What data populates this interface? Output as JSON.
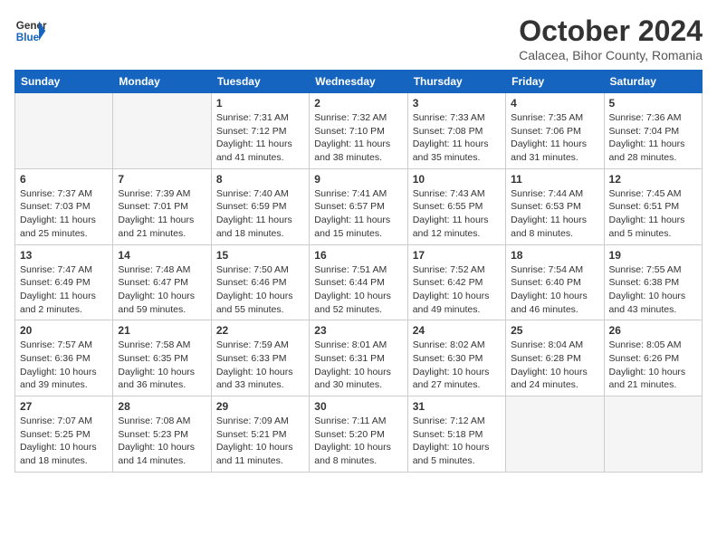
{
  "header": {
    "logo": {
      "line1": "General",
      "line2": "Blue"
    },
    "title": "October 2024",
    "subtitle": "Calacea, Bihor County, Romania"
  },
  "weekdays": [
    "Sunday",
    "Monday",
    "Tuesday",
    "Wednesday",
    "Thursday",
    "Friday",
    "Saturday"
  ],
  "weeks": [
    [
      {
        "day": "",
        "info": ""
      },
      {
        "day": "",
        "info": ""
      },
      {
        "day": "1",
        "info": "Sunrise: 7:31 AM\nSunset: 7:12 PM\nDaylight: 11 hours and 41 minutes."
      },
      {
        "day": "2",
        "info": "Sunrise: 7:32 AM\nSunset: 7:10 PM\nDaylight: 11 hours and 38 minutes."
      },
      {
        "day": "3",
        "info": "Sunrise: 7:33 AM\nSunset: 7:08 PM\nDaylight: 11 hours and 35 minutes."
      },
      {
        "day": "4",
        "info": "Sunrise: 7:35 AM\nSunset: 7:06 PM\nDaylight: 11 hours and 31 minutes."
      },
      {
        "day": "5",
        "info": "Sunrise: 7:36 AM\nSunset: 7:04 PM\nDaylight: 11 hours and 28 minutes."
      }
    ],
    [
      {
        "day": "6",
        "info": "Sunrise: 7:37 AM\nSunset: 7:03 PM\nDaylight: 11 hours and 25 minutes."
      },
      {
        "day": "7",
        "info": "Sunrise: 7:39 AM\nSunset: 7:01 PM\nDaylight: 11 hours and 21 minutes."
      },
      {
        "day": "8",
        "info": "Sunrise: 7:40 AM\nSunset: 6:59 PM\nDaylight: 11 hours and 18 minutes."
      },
      {
        "day": "9",
        "info": "Sunrise: 7:41 AM\nSunset: 6:57 PM\nDaylight: 11 hours and 15 minutes."
      },
      {
        "day": "10",
        "info": "Sunrise: 7:43 AM\nSunset: 6:55 PM\nDaylight: 11 hours and 12 minutes."
      },
      {
        "day": "11",
        "info": "Sunrise: 7:44 AM\nSunset: 6:53 PM\nDaylight: 11 hours and 8 minutes."
      },
      {
        "day": "12",
        "info": "Sunrise: 7:45 AM\nSunset: 6:51 PM\nDaylight: 11 hours and 5 minutes."
      }
    ],
    [
      {
        "day": "13",
        "info": "Sunrise: 7:47 AM\nSunset: 6:49 PM\nDaylight: 11 hours and 2 minutes."
      },
      {
        "day": "14",
        "info": "Sunrise: 7:48 AM\nSunset: 6:47 PM\nDaylight: 10 hours and 59 minutes."
      },
      {
        "day": "15",
        "info": "Sunrise: 7:50 AM\nSunset: 6:46 PM\nDaylight: 10 hours and 55 minutes."
      },
      {
        "day": "16",
        "info": "Sunrise: 7:51 AM\nSunset: 6:44 PM\nDaylight: 10 hours and 52 minutes."
      },
      {
        "day": "17",
        "info": "Sunrise: 7:52 AM\nSunset: 6:42 PM\nDaylight: 10 hours and 49 minutes."
      },
      {
        "day": "18",
        "info": "Sunrise: 7:54 AM\nSunset: 6:40 PM\nDaylight: 10 hours and 46 minutes."
      },
      {
        "day": "19",
        "info": "Sunrise: 7:55 AM\nSunset: 6:38 PM\nDaylight: 10 hours and 43 minutes."
      }
    ],
    [
      {
        "day": "20",
        "info": "Sunrise: 7:57 AM\nSunset: 6:36 PM\nDaylight: 10 hours and 39 minutes."
      },
      {
        "day": "21",
        "info": "Sunrise: 7:58 AM\nSunset: 6:35 PM\nDaylight: 10 hours and 36 minutes."
      },
      {
        "day": "22",
        "info": "Sunrise: 7:59 AM\nSunset: 6:33 PM\nDaylight: 10 hours and 33 minutes."
      },
      {
        "day": "23",
        "info": "Sunrise: 8:01 AM\nSunset: 6:31 PM\nDaylight: 10 hours and 30 minutes."
      },
      {
        "day": "24",
        "info": "Sunrise: 8:02 AM\nSunset: 6:30 PM\nDaylight: 10 hours and 27 minutes."
      },
      {
        "day": "25",
        "info": "Sunrise: 8:04 AM\nSunset: 6:28 PM\nDaylight: 10 hours and 24 minutes."
      },
      {
        "day": "26",
        "info": "Sunrise: 8:05 AM\nSunset: 6:26 PM\nDaylight: 10 hours and 21 minutes."
      }
    ],
    [
      {
        "day": "27",
        "info": "Sunrise: 7:07 AM\nSunset: 5:25 PM\nDaylight: 10 hours and 18 minutes."
      },
      {
        "day": "28",
        "info": "Sunrise: 7:08 AM\nSunset: 5:23 PM\nDaylight: 10 hours and 14 minutes."
      },
      {
        "day": "29",
        "info": "Sunrise: 7:09 AM\nSunset: 5:21 PM\nDaylight: 10 hours and 11 minutes."
      },
      {
        "day": "30",
        "info": "Sunrise: 7:11 AM\nSunset: 5:20 PM\nDaylight: 10 hours and 8 minutes."
      },
      {
        "day": "31",
        "info": "Sunrise: 7:12 AM\nSunset: 5:18 PM\nDaylight: 10 hours and 5 minutes."
      },
      {
        "day": "",
        "info": ""
      },
      {
        "day": "",
        "info": ""
      }
    ]
  ]
}
